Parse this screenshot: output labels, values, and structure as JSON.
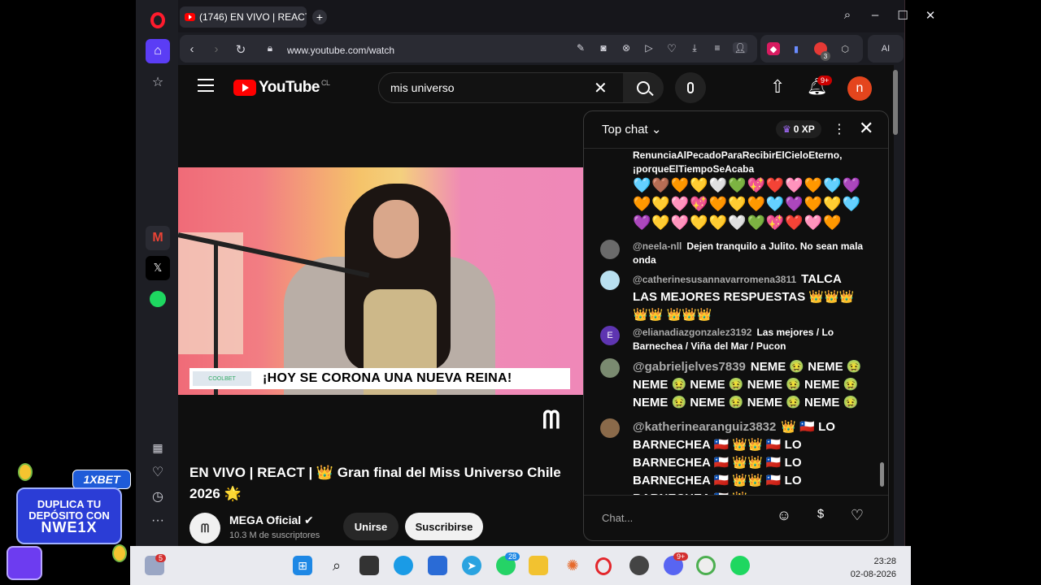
{
  "browser": {
    "tab_title": "(1746) EN VIVO | REACT |",
    "tab_suffix": "1",
    "url": "www.youtube.com/watch",
    "ai_label": "AI",
    "ext_badge": "3"
  },
  "youtube": {
    "country": "CL",
    "logo_text": "YouTube",
    "search_value": "mis universo",
    "notif_badge": "9+",
    "avatar_letter": "n"
  },
  "video": {
    "lower_third": "¡HOY SE CORONA UNA NUEVA REINA!",
    "lower_logo": "COOLBET"
  },
  "watch": {
    "title": "EN VIVO | REACT | 👑 Gran final del Miss Universo Chile 2026 🌟",
    "channel_name": "MEGA Oficial ✔",
    "channel_subs": "10.3 M de suscriptores",
    "join_label": "Unirse",
    "subscribe_label": "Suscribirse"
  },
  "chat": {
    "header": "Top chat ⌄",
    "xp": "0 XP",
    "input_placeholder": "Chat...",
    "messages": [
      {
        "author": "",
        "text": "RenunciaAlPecadoParaRecibirElCieloEterno, ¡porqueElTiempoSeAcaba",
        "emoji": "🩵🤎🧡💛🤍💚💖❤️🩷🧡🩵💜🧡💛🩷💖🧡💛🧡🩵💜🧡💛🩵💜💛🩷💛💛🤍💚💖❤️🩷🧡"
      },
      {
        "author": "@neela-nll",
        "text": "Dejen tranquilo a Julito. No sean mala onda"
      },
      {
        "author": "@catherinesusannavarromena3811",
        "text": "TALCA LAS MEJORES RESPUESTAS 👑👑👑👑👑 👑👑👑"
      },
      {
        "author": "@elianadiazgonzalez3192",
        "text": "Las mejores / Lo Barnechea / Viña del Mar / Pucon"
      },
      {
        "author": "@gabrieljelves7839",
        "text": "NEME 🤢 NEME 🤢 NEME 🤢 NEME 🤢 NEME 🤢 NEME 🤢 NEME 🤢 NEME 🤢 NEME 🤢 NEME 🤢"
      },
      {
        "author": "@katherinearanguiz3832",
        "text": "👑 🇨🇱 LO BARNECHEA 🇨🇱 👑👑 🇨🇱 LO BARNECHEA 🇨🇱 👑👑 🇨🇱 LO BARNECHEA 🇨🇱 👑👑 🇨🇱 LO BARNECHEA 🇨🇱 👑"
      }
    ]
  },
  "ad": {
    "brand": "1XBET",
    "line1": "DUPLICA TU",
    "line2": "DEPÓSITO CON",
    "code": "NWE1X"
  },
  "taskbar": {
    "time": "23:28",
    "date": "02-08-2026",
    "badge_a": "5",
    "badge_b": "28",
    "badge_c": "9+"
  }
}
